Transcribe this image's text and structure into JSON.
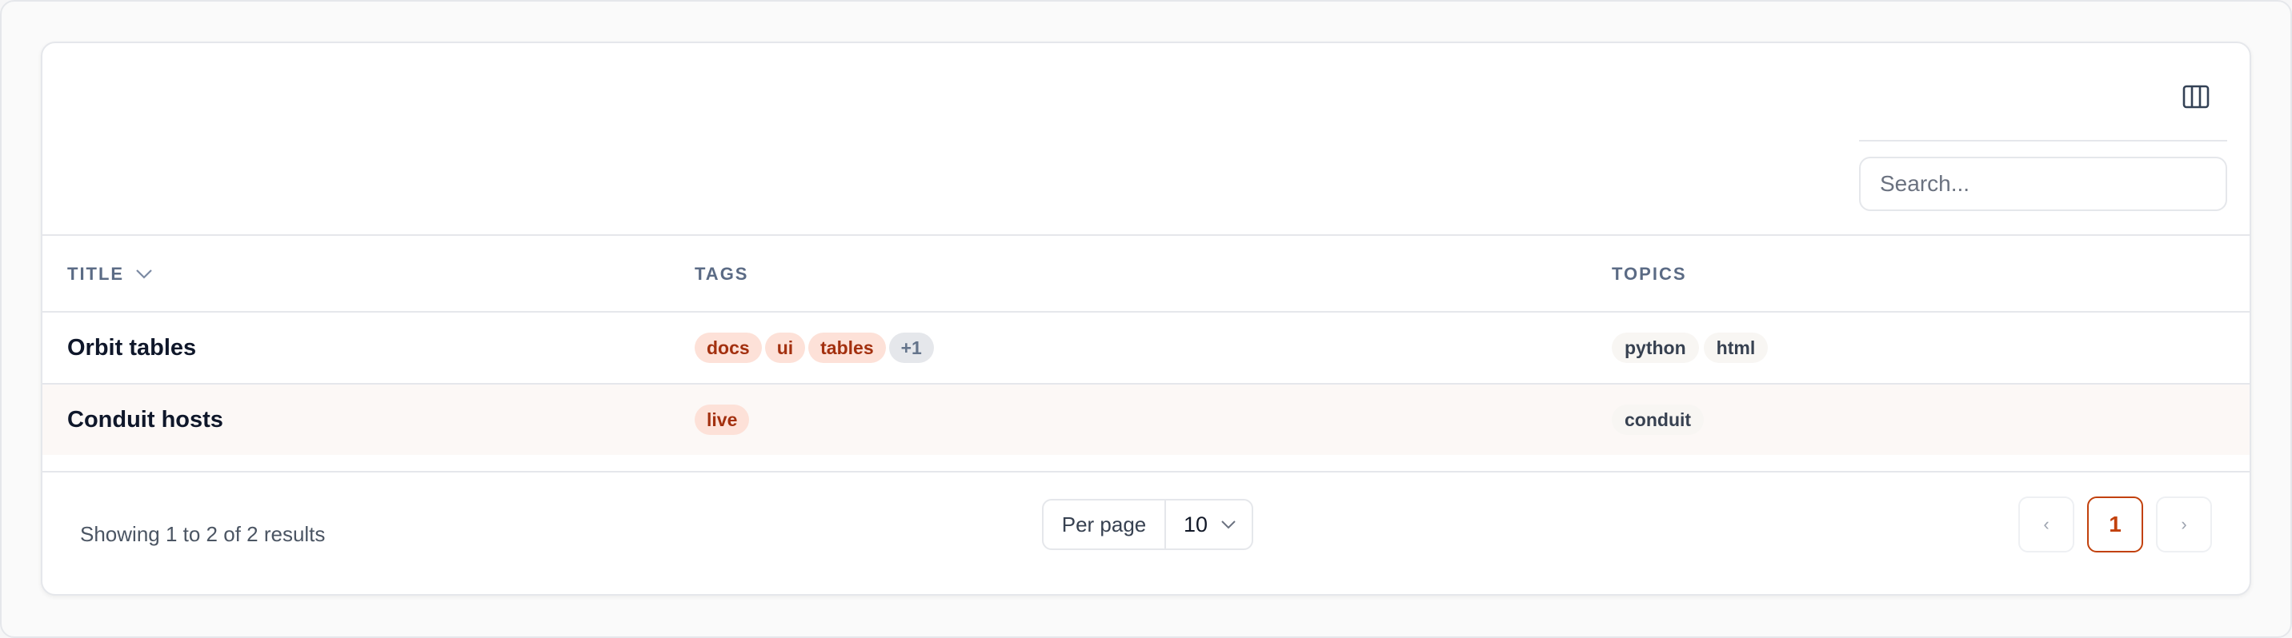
{
  "search": {
    "placeholder": "Search..."
  },
  "columns": {
    "title": "TITLE",
    "tags": "TAGS",
    "topics": "TOPICS"
  },
  "rows": [
    {
      "title": "Orbit tables",
      "tags": [
        "docs",
        "ui",
        "tables"
      ],
      "more": "+1",
      "topics": [
        "python",
        "html"
      ]
    },
    {
      "title": "Conduit hosts",
      "tags": [
        "live"
      ],
      "topics": [
        "conduit"
      ]
    }
  ],
  "footer": {
    "results": "Showing 1 to 2 of 2 results",
    "per_page_label": "Per page",
    "per_page_value": "10",
    "prev": "‹",
    "current_page": "1",
    "next": "›"
  },
  "colors": {
    "accent": "#c2410c",
    "tag_bg": "#fde1d8",
    "tag_text": "#a3300f"
  },
  "icons": {
    "columns": "columns-icon",
    "sort": "chevron-down-icon",
    "select": "chevron-down-icon"
  }
}
